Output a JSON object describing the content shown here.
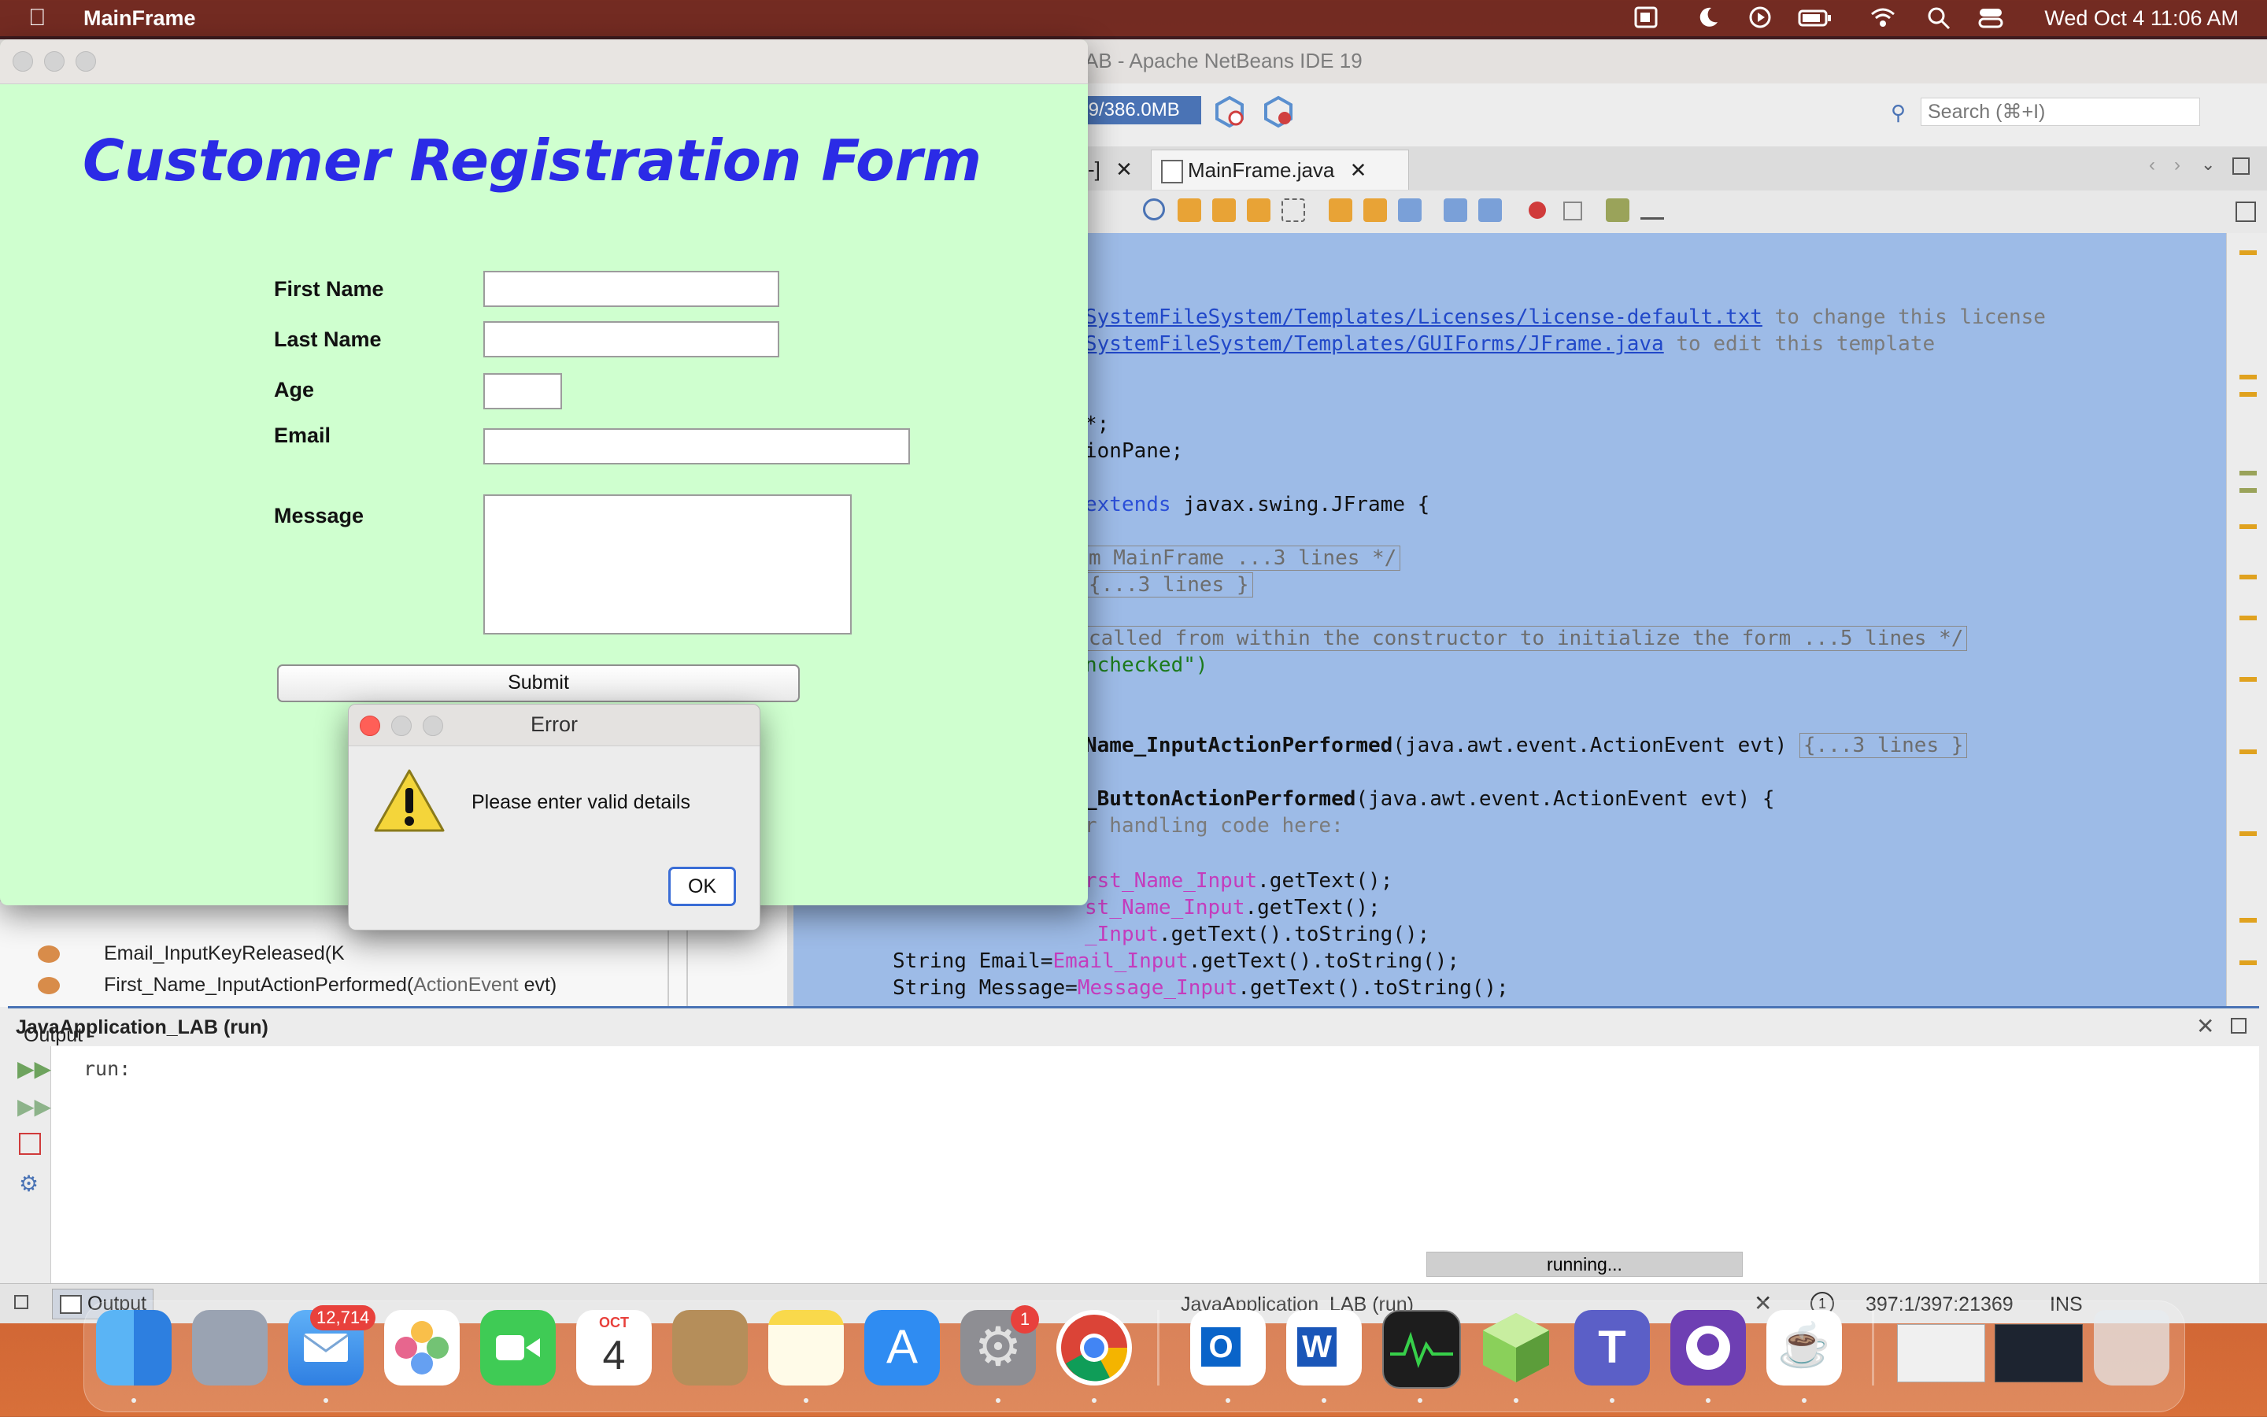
{
  "menubar": {
    "app_name": "MainFrame",
    "clock": "Wed Oct 4  11:06 AM"
  },
  "netbeans": {
    "window_title": "AB - Apache NetBeans IDE 19",
    "memory": ".9/386.0MB",
    "search_placeholder": "Search (⌘+I)",
    "tab_prev": "-]",
    "tab_active": "MainFrame.java",
    "code": {
      "l1a": "SystemFileSystem/Templates/Licenses/license-default.txt",
      "l1b": " to change this license",
      "l2a": "SystemFileSystem/Templates/GUIForms/JFrame.java",
      "l2b": " to edit this template",
      "l3": "*;",
      "l4": "ionPane;",
      "l5a": "extends",
      "l5b": " javax.swing.JFrame {",
      "l6": "m MainFrame ...3 lines */",
      "l7": "{...3 lines }",
      "l8": "called from within the constructor to initialize the form ...5 lines */",
      "l9": "nchecked\")",
      "l10a": "Name_InputActionPerformed",
      "l10b": "(java.awt.event.ActionEvent evt) ",
      "l10c": "{...3 lines }",
      "l11a": "_ButtonActionPerformed",
      "l11b": "(java.awt.event.ActionEvent evt) {",
      "l12": "r handling code here:",
      "l13a": "rst_Name_Input",
      "l13b": ".getText();",
      "l14a": "st_Name_Input",
      "l14b": ".getText();",
      "l15a": "_Input",
      "l15b": ".getText().toString();",
      "l16a": "String Email=",
      "l16b": "Email_Input",
      "l16c": ".getText().toString();",
      "l17a": "String Message=",
      "l17b": "Message_Input",
      "l17c": ".getText().toString();"
    },
    "navigator": {
      "item1": "Email_InputKeyReleased(K",
      "item2_a": "First_Name_InputActionPerformed(",
      "item2_b": "ActionEvent",
      "item2_c": " evt)"
    },
    "output": {
      "title_prefix": "Output - ",
      "title_bold": "JavaApplication_LAB (run)",
      "run_text": "run:",
      "tab_label": "Output"
    },
    "status": {
      "project": "JavaApplication_LAB (run)",
      "progress_text": "running...",
      "position": "397:1/397:21369",
      "mode": "INS",
      "notifications": "1"
    }
  },
  "form": {
    "window_title": "",
    "title": "Customer Registration Form",
    "first_name_label": "First Name",
    "last_name_label": "Last Name",
    "age_label": "Age",
    "email_label": "Email",
    "message_label": "Message",
    "submit_label": "Submit",
    "first_name_value": "",
    "last_name_value": "",
    "age_value": "",
    "email_value": "",
    "message_value": ""
  },
  "dialog": {
    "title": "Error",
    "message": "Please enter valid details",
    "ok_label": "OK"
  },
  "dock": {
    "mail_badge": "12,714",
    "calendar_month": "OCT",
    "calendar_day": "4",
    "settings_badge": "1"
  }
}
